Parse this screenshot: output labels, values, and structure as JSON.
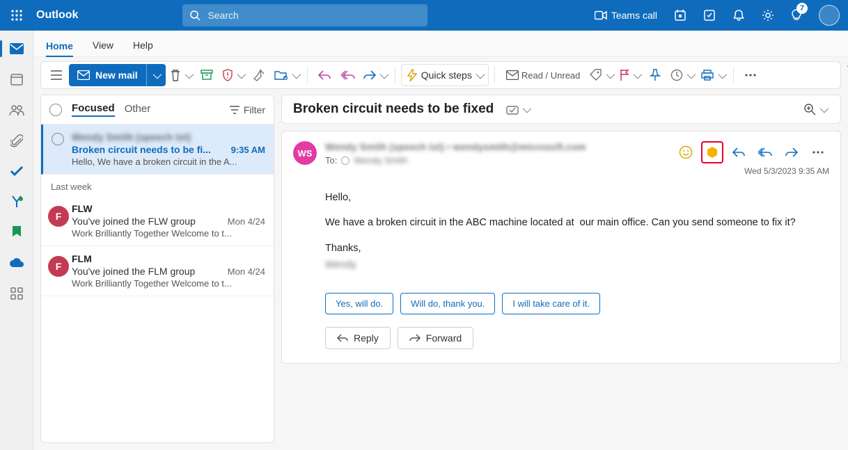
{
  "header": {
    "brand": "Outlook",
    "search_placeholder": "Search",
    "teams_call": "Teams call",
    "diagnostics_badge": "7"
  },
  "tabs": {
    "home": "Home",
    "view": "View",
    "help": "Help"
  },
  "ribbon": {
    "new_mail": "New mail",
    "quick_steps": "Quick steps",
    "read_unread": "Read / Unread"
  },
  "list": {
    "focused": "Focused",
    "other": "Other",
    "filter": "Filter",
    "group_label": "Last week",
    "items": [
      {
        "from_masked": "Wendy Smith (speech txt)",
        "subject": "Broken circuit needs to be fi...",
        "time": "9:35 AM",
        "preview": "Hello, We have a broken circuit in the A..."
      },
      {
        "initial": "F",
        "from": "FLW",
        "subject": "You've joined the FLW group",
        "time": "Mon 4/24",
        "preview": "Work Brilliantly Together Welcome to t..."
      },
      {
        "initial": "F",
        "from": "FLM",
        "subject": "You've joined the FLM group",
        "time": "Mon 4/24",
        "preview": "Work Brilliantly Together Welcome to t..."
      }
    ]
  },
  "reader": {
    "title": "Broken circuit needs to be fixed",
    "from_initials": "WS",
    "from_masked": "Wendy Smith (speech txt)  •  wendysmith@microsoft.com",
    "to_label": "To:",
    "to_masked": "Wendy Smith",
    "timestamp": "Wed 5/3/2023 9:35 AM",
    "body": {
      "greeting": "Hello,",
      "para": "We have a broken circuit in the ABC machine located at  our main office. Can you send someone to fix it?",
      "thanks": "Thanks,",
      "sig_masked": "Wendy"
    },
    "suggestions": [
      "Yes, will do.",
      "Will do, thank you.",
      "I will take care of it."
    ],
    "reply": "Reply",
    "forward": "Forward"
  }
}
